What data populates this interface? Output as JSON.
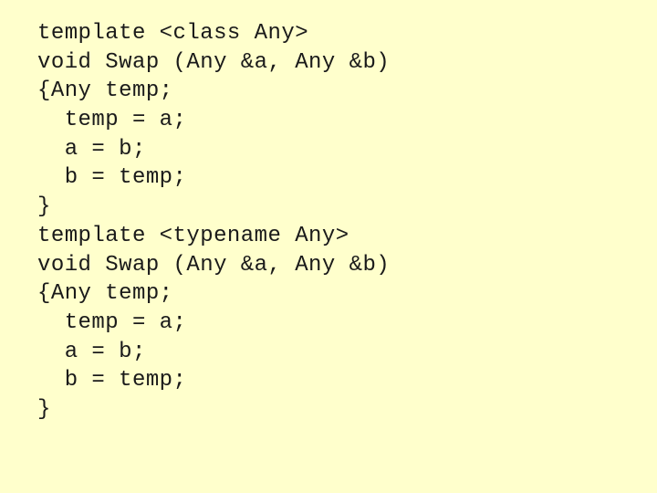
{
  "slide": {
    "background_color": "#ffffcc",
    "text_color": "#1a1a1a",
    "kind": "code-listing-slide",
    "language": "C++",
    "code_lines": [
      {
        "id": "line-1",
        "text": "template <class Any>"
      },
      {
        "id": "line-2",
        "text": "void Swap (Any &a, Any &b)"
      },
      {
        "id": "line-3",
        "text": "{Any temp;"
      },
      {
        "id": "line-4",
        "text": "  temp = a;"
      },
      {
        "id": "line-5",
        "text": "  a = b;"
      },
      {
        "id": "line-6",
        "text": "  b = temp;"
      },
      {
        "id": "line-7",
        "text": "}"
      },
      {
        "id": "line-8",
        "text": "template <typename Any>"
      },
      {
        "id": "line-9",
        "text": "void Swap (Any &a, Any &b)"
      },
      {
        "id": "line-10",
        "text": "{Any temp;"
      },
      {
        "id": "line-11",
        "text": "  temp = a;"
      },
      {
        "id": "line-12",
        "text": "  a = b;"
      },
      {
        "id": "line-13",
        "text": "  b = temp;"
      },
      {
        "id": "line-14",
        "text": "}"
      }
    ]
  }
}
